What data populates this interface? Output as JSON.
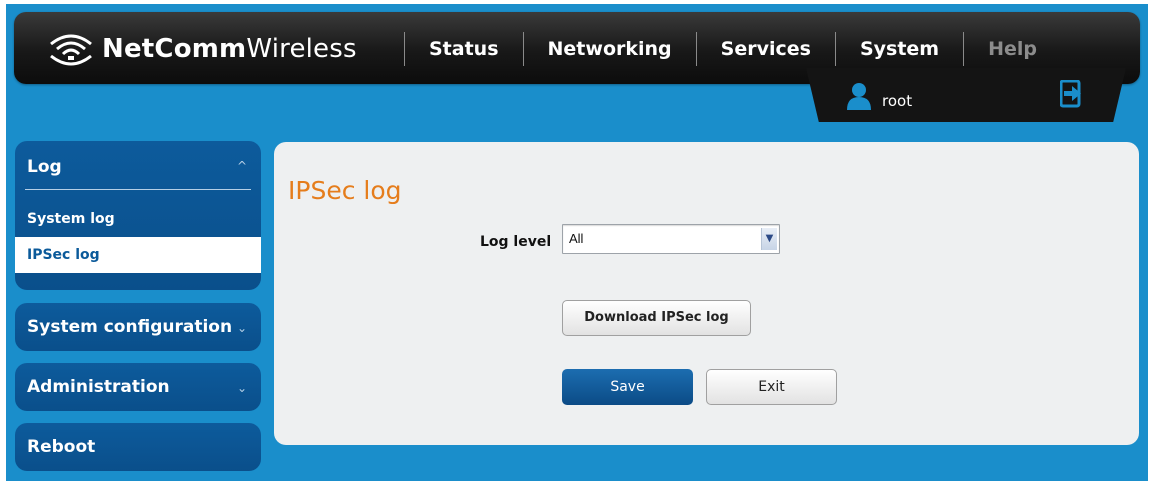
{
  "brand": {
    "name_bold": "NetComm",
    "name_light": "Wireless"
  },
  "nav": {
    "items": [
      {
        "label": "Status"
      },
      {
        "label": "Networking"
      },
      {
        "label": "Services"
      },
      {
        "label": "System"
      },
      {
        "label": "Help"
      }
    ]
  },
  "user": {
    "name": "root"
  },
  "sidebar": {
    "log": {
      "label": "Log",
      "items": [
        {
          "label": "System log"
        },
        {
          "label": "IPSec log"
        }
      ]
    },
    "sections": [
      {
        "label": "System configuration"
      },
      {
        "label": "Administration"
      },
      {
        "label": "Reboot"
      }
    ]
  },
  "main": {
    "title": "IPSec log",
    "log_level": {
      "label": "Log level",
      "value": "All"
    },
    "download_label": "Download IPSec log",
    "save_label": "Save",
    "exit_label": "Exit"
  },
  "colors": {
    "background": "#1a8ecb",
    "header": "#141414",
    "sidebar": "#0b5a9a",
    "title_accent": "#e57d1c"
  }
}
